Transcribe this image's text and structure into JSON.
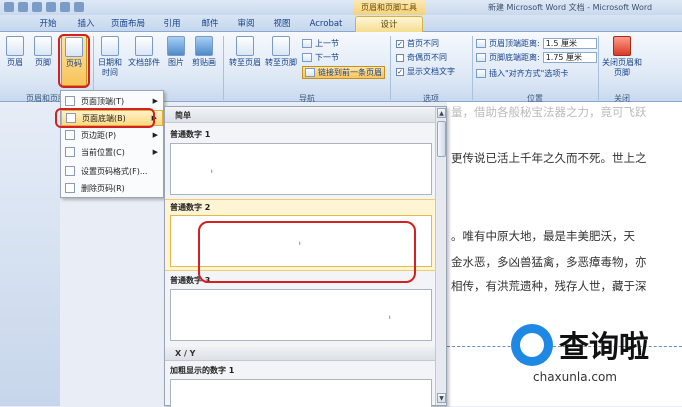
{
  "window": {
    "context_title": "页眉和页脚工具",
    "doc_title": "新建 Microsoft Word 文档 - Microsoft Word"
  },
  "tabs": [
    "开始",
    "插入",
    "页面布局",
    "引用",
    "邮件",
    "审阅",
    "视图",
    "Acrobat",
    "设计"
  ],
  "ribbon": {
    "header_footer_group": {
      "label": "页眉和页脚",
      "buttons": [
        "页眉",
        "页脚",
        "页码"
      ]
    },
    "insert_group": {
      "buttons": [
        "日期和时间",
        "文档部件",
        "图片",
        "剪贴画"
      ]
    },
    "nav_group": {
      "label": "导航",
      "goto_header": "转至页眉",
      "goto_footer": "转至页脚",
      "prev_section": "上一节",
      "next_section": "下一节",
      "link_previous": "链接到前一条页眉"
    },
    "options_group": {
      "label": "选项",
      "first_page_diff": "首页不同",
      "odd_even_diff": "奇偶页不同",
      "show_doc_text": "显示文档文字"
    },
    "position_group": {
      "label": "位置",
      "header_top_label": "页眉顶端距离:",
      "header_top_value": "1.5 厘米",
      "footer_bottom_label": "页脚底端距离:",
      "footer_bottom_value": "1.75 厘米",
      "insert_align_tab": "插入\"对齐方式\"选项卡"
    },
    "close_group": {
      "label": "关闭",
      "close_button": "关闭页眉和页脚"
    }
  },
  "page_number_menu": {
    "items": [
      {
        "label": "页面顶端(T)",
        "has_submenu": true
      },
      {
        "label": "页面底端(B)",
        "has_submenu": true,
        "selected": true
      },
      {
        "label": "页边距(P)",
        "has_submenu": true
      },
      {
        "label": "当前位置(C)",
        "has_submenu": true
      },
      {
        "label": "设置页码格式(F)...",
        "has_submenu": false
      },
      {
        "label": "删除页码(R)",
        "has_submenu": false
      }
    ]
  },
  "gallery": {
    "section_simple": "简单",
    "section_xy": "X / Y",
    "items": [
      "普通数字 1",
      "普通数字 2",
      "普通数字 3",
      "加粗显示的数字 1"
    ]
  },
  "document": {
    "lines": [
      "量，借助各般秘宝法器之力，竟可飞跃",
      "更传说已活上千年之久而不死。世上之",
      "。唯有中原大地，最是丰美肥沃，天",
      "金水恶，多凶兽猛禽，多恶瘴毒物，亦",
      "相传，有洪荒遗种，残存人世，藏于深"
    ]
  },
  "watermark": {
    "cn": "查询啦",
    "en": "chaxunla.com"
  },
  "colors": {
    "accent_red": "#d42020",
    "ribbon_blue": "#15428b",
    "highlight": "#fbd982"
  }
}
